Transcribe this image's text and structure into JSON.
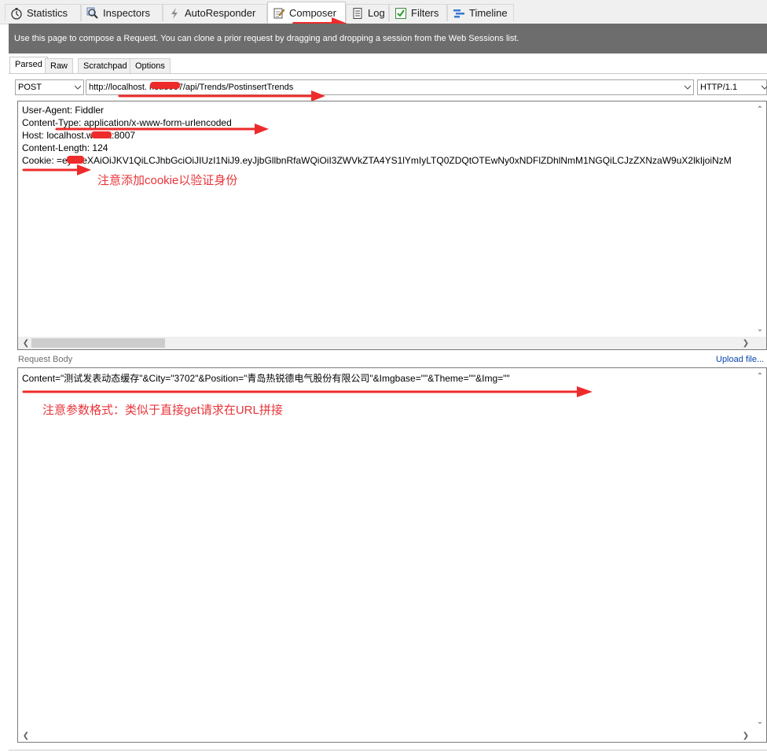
{
  "tabs": [
    {
      "label": "Statistics",
      "icon": "stopwatch-icon"
    },
    {
      "label": "Inspectors",
      "icon": "magnifier-icon"
    },
    {
      "label": "AutoResponder",
      "icon": "lightning-icon"
    },
    {
      "label": "Composer",
      "icon": "pencil-pad-icon",
      "active": true
    },
    {
      "label": "Log",
      "icon": "document-icon"
    },
    {
      "label": "Filters",
      "icon": "checkbox-icon"
    },
    {
      "label": "Timeline",
      "icon": "timeline-icon"
    }
  ],
  "banner": {
    "text": "Use this page to compose a Request. You can clone a prior request by dragging and dropping a session from the Web Sessions list."
  },
  "subtabs": [
    {
      "label": "Parsed",
      "active": true
    },
    {
      "label": "Raw"
    },
    {
      "label": "Scratchpad"
    },
    {
      "label": "Options"
    }
  ],
  "request_line": {
    "method": "POST",
    "url": "http://localhost.          net:8007/api/Trends/PostinsertTrends",
    "version": "HTTP/1.1"
  },
  "headers": {
    "lines": [
      "User-Agent: Fiddler",
      "Content-Type: application/x-www-form-urlencoded",
      "Host: localhost.w      .net:8007",
      "Content-Length: 124",
      "Cookie:      =eyJ0eXAiOiJKV1QiLCJhbGciOiJIUzI1NiJ9.eyJjbGllbnRfaWQiOiI3ZWVkZTA4YS1lYmIyLTQ0ZDQtOTEwNy0xNDFlZDhlNmM1NGQiLCJzZXNzaW9uX2lkIjoiNzM"
    ],
    "annotation": "注意添加cookie以验证身份"
  },
  "body": {
    "label": "Request Body",
    "upload_label": "Upload file...",
    "content": "Content=\"测试发表动态缓存\"&City=\"3702\"&Position=\"青岛热锐德电气股份有限公司\"&Imgbase=\"\"&Theme=\"\"&Img=\"\"",
    "annotation": "注意参数格式：类似于直接get请求在URL拼接"
  },
  "colors": {
    "banner_bg": "#6d6d6d",
    "annotation_red": "#e8343a",
    "link_blue": "#0645ad"
  }
}
